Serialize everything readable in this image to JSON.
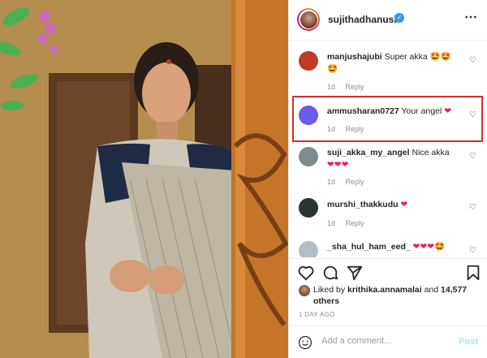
{
  "header": {
    "username": "sujithadhanush",
    "more_icon": "⋯"
  },
  "comments": [
    {
      "username": "manjushajubi",
      "text": "Super akka",
      "emoji": "🤩🤩🤩",
      "time": "1d",
      "reply": "Reply",
      "avatar_color": "#c0392b"
    },
    {
      "username": "ammusharan0727",
      "text": "Your angel",
      "emoji": "❤",
      "time": "1d",
      "reply": "Reply",
      "avatar_color": "#6c5ce7"
    },
    {
      "username": "suji_akka_my_angel",
      "text": "Nice akka",
      "emoji": "❤❤❤",
      "time": "1d",
      "reply": "Reply",
      "avatar_color": "#7f8c8d"
    },
    {
      "username": "murshi_thakkudu",
      "text": "",
      "emoji": "❤",
      "time": "1d",
      "reply": "Reply",
      "avatar_color": "#2d3436"
    },
    {
      "username": "_sha_hul_ham_eed_",
      "text": "",
      "emoji": "❤❤❤🤩",
      "time": "",
      "reply": "",
      "avatar_color": "#b2bec3"
    }
  ],
  "likes": {
    "prefix": "Liked by",
    "user": "krithika.annamalai",
    "and": "and",
    "others": "14,577 others"
  },
  "time_ago": "1 DAY AGO",
  "add_comment": {
    "placeholder": "Add a comment...",
    "post_label": "Post"
  },
  "colors": {
    "highlight": "#d92b2b",
    "heart": "#e0245e",
    "verified": "#3897f0"
  }
}
